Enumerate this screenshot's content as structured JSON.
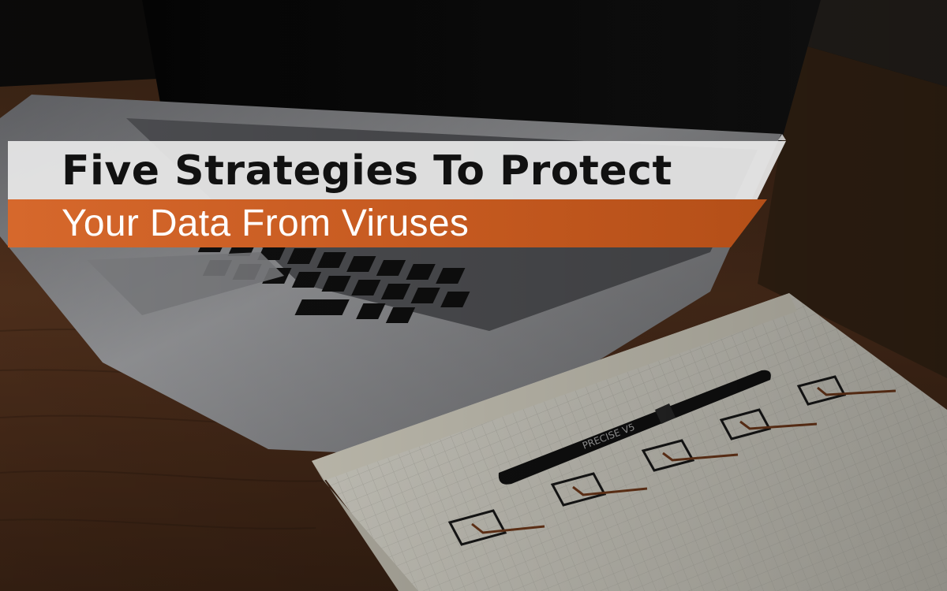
{
  "banner": {
    "title_line1": "Five Strategies To Protect",
    "title_line2": "Your Data From Viruses",
    "colors": {
      "top_band": "#e8e8e8",
      "bottom_band": "#c65a20",
      "line1_text": "#111111",
      "line2_text": "#ffffff"
    }
  },
  "photo": {
    "pen_brand": "PRECISE V5",
    "checklist_count": 5,
    "icons": [
      "laptop-icon",
      "pen-icon",
      "checkbox-icon"
    ]
  }
}
